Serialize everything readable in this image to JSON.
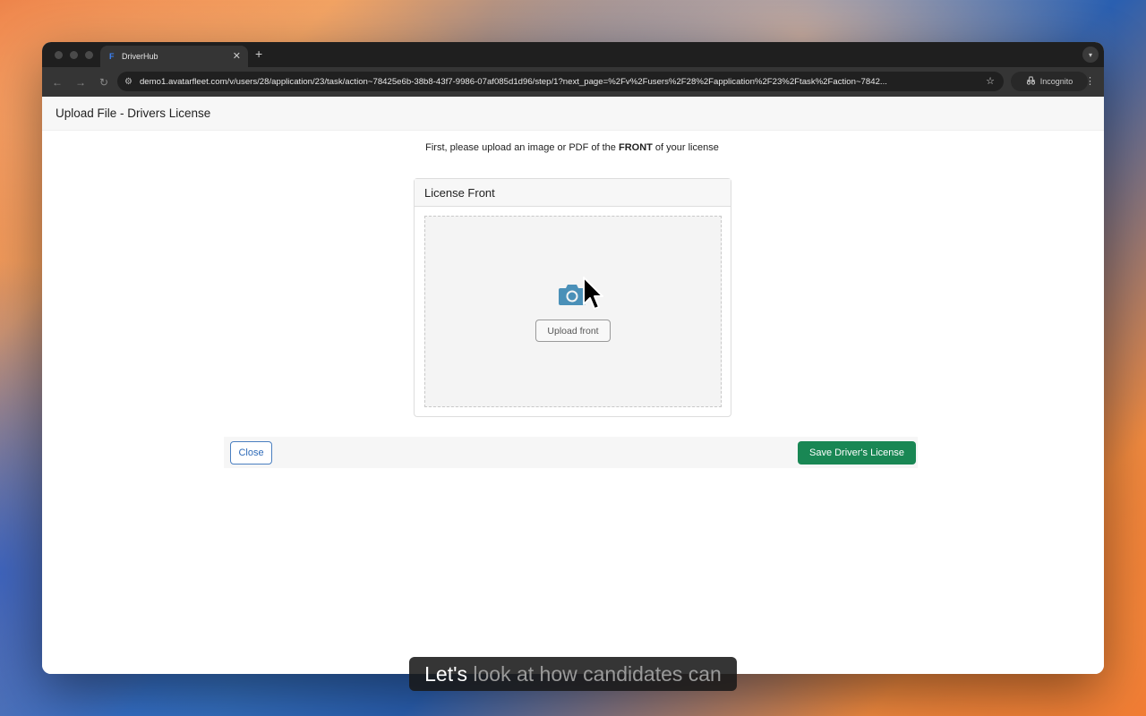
{
  "browser": {
    "tab_title": "DriverHub",
    "tab_favicon": "F",
    "url": "demo1.avatarfleet.com/v/users/28/application/23/task/action~78425e6b-38b8-43f7-9986-07af085d1d96/step/1?next_page=%2Fv%2Fusers%2F28%2Fapplication%2F23%2Ftask%2Faction~7842...",
    "incognito_label": "Incognito"
  },
  "page": {
    "title": "Upload File - Drivers License",
    "instruction_prefix": "First, please upload an image or PDF of the ",
    "instruction_bold": "FRONT",
    "instruction_suffix": " of your license",
    "card_title": "License Front",
    "upload_button": "Upload front",
    "close_button": "Close",
    "save_button": "Save Driver's License",
    "accent_color": "#198754",
    "camera_icon_color": "#4a90b8"
  },
  "caption": {
    "highlight": "Let's",
    "rest": " look at how candidates can"
  }
}
